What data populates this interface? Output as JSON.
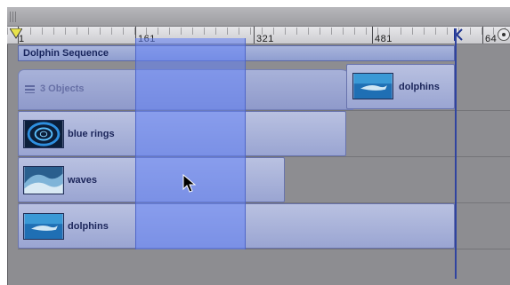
{
  "ruler": {
    "labels": [
      "1",
      "161",
      "321",
      "481",
      "64"
    ]
  },
  "sequence": {
    "title": "Dolphin Sequence"
  },
  "group": {
    "label": "3 Objects"
  },
  "clips": [
    {
      "label": "dolphins",
      "thumbnail": "dolphins-thumbnail"
    },
    {
      "label": "blue rings",
      "thumbnail": "blue-rings-thumbnail"
    },
    {
      "label": "waves",
      "thumbnail": "waves-thumbnail"
    },
    {
      "label": "dolphins",
      "thumbnail": "dolphins-thumbnail"
    }
  ],
  "colors": {
    "selection": "#6080f5",
    "clip": "#a5afd9",
    "track_bg": "#8d8d91",
    "end_line": "#3044a0"
  }
}
